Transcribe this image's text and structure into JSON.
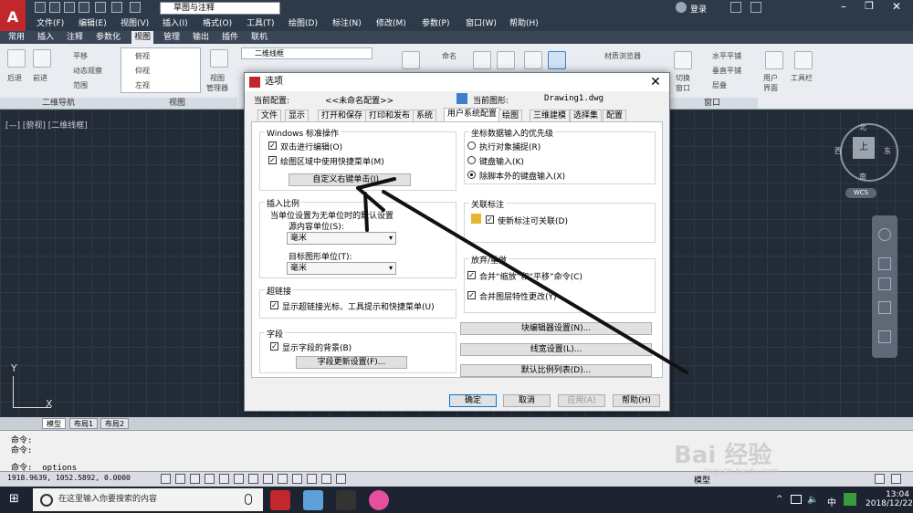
{
  "app": {
    "logo": "A",
    "workspace": "草图与注释",
    "login": "登录"
  },
  "menubar": [
    "文件(F)",
    "编辑(E)",
    "视图(V)",
    "插入(I)",
    "格式(O)",
    "工具(T)",
    "绘图(D)",
    "标注(N)",
    "修改(M)",
    "参数(P)",
    "窗口(W)",
    "帮助(H)"
  ],
  "ribbon_tabs": [
    "常用",
    "插入",
    "注释",
    "参数化",
    "视图",
    "管理",
    "输出",
    "插件",
    "联机"
  ],
  "ribbon_active_tab": "视图",
  "ribbon": {
    "nav_labels": [
      "后退",
      "前进",
      "平移",
      "动态观察",
      "范围"
    ],
    "view_items": [
      "俯视",
      "仰视",
      "左视"
    ],
    "view_manager": "视图\n管理器",
    "visual_style": "二维线框",
    "named": "命名",
    "panel_nav": "二维导航",
    "panel_view": "视图",
    "panel_window": "窗口",
    "window_items": [
      "水平平铺",
      "垂直平铺",
      "层叠"
    ],
    "material": "材质浏览器",
    "user_interface": "用户\n界面",
    "toolbar": "工具栏",
    "switch": "切换\n窗口"
  },
  "viewport": {
    "label": "[—] [俯视] [二维线框]",
    "compass": {
      "n": "北",
      "s": "南",
      "e": "东",
      "w": "西",
      "top": "上"
    },
    "wcs": "WCS",
    "ucs_x": "X",
    "ucs_y": "Y"
  },
  "layout_tabs": [
    "模型",
    "布局1",
    "布局2"
  ],
  "command": {
    "line1": "命令:",
    "line2": "命令:",
    "line3": "命令: _options"
  },
  "status": {
    "coords": "1918.9639, 1052.5892, 0.0000",
    "model": "模型"
  },
  "dialog": {
    "title": "选项",
    "current_config_label": "当前配置:",
    "current_config_value": "<<未命名配置>>",
    "current_drawing_label": "当前图形:",
    "current_drawing_value": "Drawing1.dwg",
    "tabs": [
      "文件",
      "显示",
      "打开和保存",
      "打印和发布",
      "系统",
      "用户系统配置",
      "绘图",
      "三维建模",
      "选择集",
      "配置"
    ],
    "active_tab": "用户系统配置",
    "windows_group": {
      "title": "Windows 标准操作",
      "dblclick": "双击进行编辑(O)",
      "shortcut_menu": "绘图区域中使用快捷菜单(M)",
      "custom_right_click": "自定义右键单击(I)..."
    },
    "insert_scale": {
      "title": "插入比例",
      "desc": "当单位设置为无单位时的默认设置",
      "source_label": "源内容单位(S):",
      "source_value": "毫米",
      "target_label": "目标图形单位(T):",
      "target_value": "毫米"
    },
    "hyperlink": {
      "title": "超链接",
      "option": "显示超链接光标、工具提示和快捷菜单(U)"
    },
    "field": {
      "title": "字段",
      "option": "显示字段的背景(B)",
      "button": "字段更新设置(F)..."
    },
    "coord_priority": {
      "title": "坐标数据输入的优先级",
      "options": [
        "执行对象捕捉(R)",
        "键盘输入(K)",
        "除脚本外的键盘输入(X)"
      ],
      "selected_index": 2
    },
    "assoc_dim": {
      "title": "关联标注",
      "option": "使新标注可关联(D)"
    },
    "undo_redo": {
      "title": "放弃/重做",
      "zoom_pan": "合并“缩放”和“平移”命令(C)",
      "layer_prop": "合并图层特性更改(Y)"
    },
    "buttons_right": [
      "块编辑器设置(N)...",
      "线宽设置(L)...",
      "默认比例列表(D)..."
    ],
    "footer": {
      "ok": "确定",
      "cancel": "取消",
      "apply": "应用(A)",
      "help": "帮助(H)"
    }
  },
  "taskbar": {
    "search_placeholder": "在这里输入你要搜索的内容",
    "time": "13:04",
    "date": "2018/12/22"
  },
  "watermark": {
    "brand": "Bai 经验",
    "url": "jingyan.baidu.com"
  }
}
